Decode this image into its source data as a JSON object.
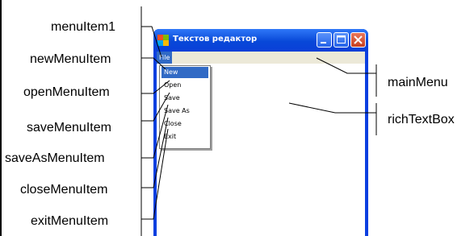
{
  "window": {
    "title": "Текстов редактор",
    "menu_file": "File",
    "menu_items": [
      "New",
      "Open",
      "Save",
      "Save As",
      "Close",
      "Exit"
    ],
    "selected_index": 0
  },
  "labels": {
    "menuItem1": "menuItem1",
    "newMenuItem": "newMenuItem",
    "openMenuItem": "openMenuItem",
    "saveMenuItem": "saveMenuItem",
    "saveAsMenuItem": "saveAsMenuItem",
    "closeMenuItem": "closeMenuItem",
    "exitMenuItem": "exitMenuItem",
    "mainMenu": "mainMenu",
    "richTextBox": "richTextBox"
  },
  "colors": {
    "title_blue": "#0a3fe0",
    "menu_highlight": "#316ac5",
    "menubar_bg": "#ece9d8"
  }
}
